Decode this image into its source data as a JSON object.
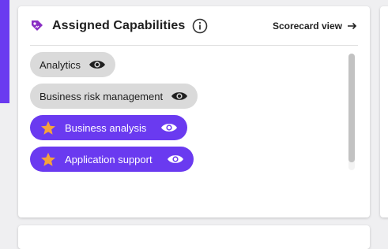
{
  "card": {
    "title": "Assigned Capabilities",
    "scorecard_link": "Scorecard view"
  },
  "capabilities": [
    {
      "label": "Analytics",
      "starred": false
    },
    {
      "label": "Business risk management",
      "starred": false
    },
    {
      "label": "Business analysis",
      "starred": true
    },
    {
      "label": "Application support",
      "starred": true
    }
  ],
  "colors": {
    "accent": "#6a3af0",
    "chip_gray": "#dadada",
    "star": "#f5a33b",
    "tag_icon": "#8a2ec4"
  },
  "icons": {
    "title_icon": "tag-icon",
    "info": "info-icon",
    "link_arrow": "arrow-right-icon",
    "visibility": "eye-icon",
    "starred": "star-icon"
  }
}
